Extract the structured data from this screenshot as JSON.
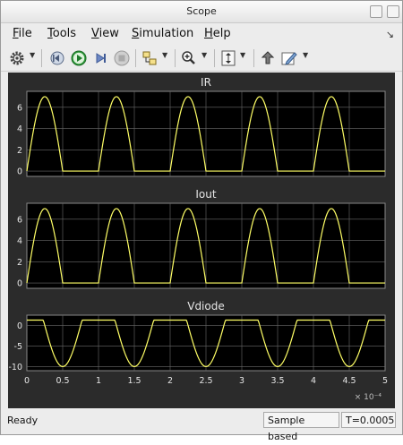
{
  "window": {
    "title": "Scope"
  },
  "menu": {
    "items": [
      {
        "first": "F",
        "rest": "ile"
      },
      {
        "first": "T",
        "rest": "ools"
      },
      {
        "first": "V",
        "rest": "iew"
      },
      {
        "first": "S",
        "rest": "imulation"
      },
      {
        "first": "H",
        "rest": "elp"
      }
    ],
    "pin": "↘"
  },
  "toolbar": {
    "icons": [
      "gear-icon",
      "step-back-icon",
      "run-icon",
      "step-forward-icon",
      "stop-icon",
      "highlight-block-icon",
      "zoom-icon",
      "autoscale-icon",
      "restore-layout-icon",
      "style-edit-icon"
    ]
  },
  "status": {
    "ready": "Ready",
    "sample": "Sample based",
    "time": "T=0.0005"
  },
  "colors": {
    "trace": "#ffff66",
    "plot_bg": "#000000",
    "canvas_bg": "#2b2b2b",
    "grid": "#6a6a6a",
    "axis_text": "#e6e6e6"
  },
  "chart_data": [
    {
      "type": "line",
      "title": "IR",
      "x_range": [
        0,
        0.0005
      ],
      "ylim": [
        -0.5,
        7.5
      ],
      "yticks": [
        "6",
        "4",
        "2",
        "0"
      ],
      "grid": true,
      "series": [
        {
          "kind": "halfwave",
          "amplitude": 7,
          "period": 0.0001,
          "first_peak": 2.5e-05,
          "floor": 0
        }
      ]
    },
    {
      "type": "line",
      "title": "Iout",
      "x_range": [
        0,
        0.0005
      ],
      "ylim": [
        -0.5,
        7.5
      ],
      "yticks": [
        "6",
        "4",
        "2",
        "0"
      ],
      "grid": true,
      "series": [
        {
          "kind": "halfwave",
          "amplitude": 7,
          "period": 0.0001,
          "first_peak": 2.5e-05,
          "floor": 0
        }
      ]
    },
    {
      "type": "line",
      "title": "Vdiode",
      "x_range": [
        0,
        0.0005
      ],
      "ylim": [
        -11,
        2.5
      ],
      "yticks": [
        "0",
        "-5",
        "-10"
      ],
      "xticks": [
        "0",
        "0.5",
        "1",
        "1.5",
        "2",
        "2.5",
        "3",
        "3.5",
        "4",
        "4.5",
        "5"
      ],
      "xscale_label": "× 10⁻⁴",
      "grid": true,
      "series": [
        {
          "kind": "diode",
          "max": 1.3,
          "min": -10,
          "period": 0.0001
        }
      ]
    }
  ]
}
